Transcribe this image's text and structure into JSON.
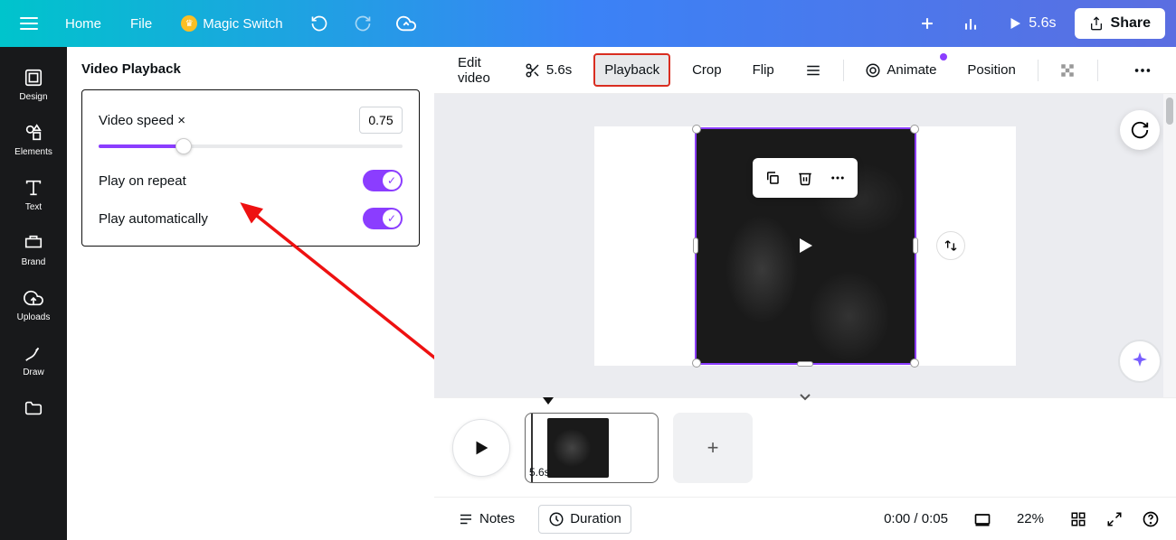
{
  "header": {
    "home": "Home",
    "file": "File",
    "magic_switch": "Magic Switch",
    "duration": "5.6s",
    "share": "Share"
  },
  "sidebar": {
    "items": [
      {
        "label": "Design"
      },
      {
        "label": "Elements"
      },
      {
        "label": "Text"
      },
      {
        "label": "Brand"
      },
      {
        "label": "Uploads"
      },
      {
        "label": "Draw"
      }
    ]
  },
  "panel": {
    "title": "Video Playback",
    "speed_label": "Video speed ×",
    "speed_value": "0.75",
    "repeat_label": "Play on repeat",
    "auto_label": "Play automatically"
  },
  "toolbar": {
    "edit_video": "Edit video",
    "duration": "5.6s",
    "playback": "Playback",
    "crop": "Crop",
    "flip": "Flip",
    "animate": "Animate",
    "position": "Position"
  },
  "timeline": {
    "clip_duration": "5.6s"
  },
  "bottom": {
    "notes": "Notes",
    "duration": "Duration",
    "time": "0:00 / 0:05",
    "zoom": "22%"
  },
  "colors": {
    "accent": "#8b3dff"
  }
}
